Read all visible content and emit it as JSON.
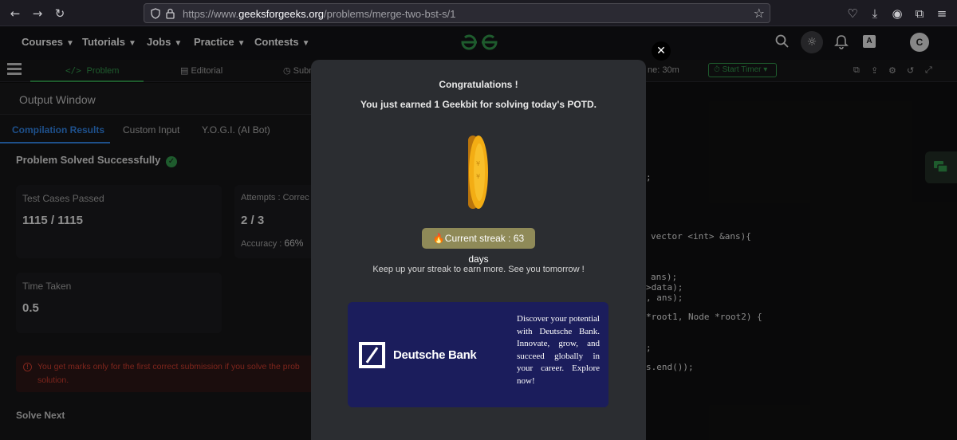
{
  "browser": {
    "url_prefix": "https://www.",
    "url_domain": "geeksforgeeks.org",
    "url_path": "/problems/merge-two-bst-s/1"
  },
  "nav": {
    "items": [
      "Courses",
      "Tutorials",
      "Jobs",
      "Practice",
      "Contests"
    ],
    "logo": "GG",
    "avatar": "C"
  },
  "tabs": {
    "problem": "Problem",
    "editorial": "Editorial",
    "submissions": "Subm",
    "time_fragment": "ne: 30m",
    "start_timer": "Start Timer"
  },
  "left": {
    "output_window": "Output Window",
    "subtabs": [
      "Compilation Results",
      "Custom Input",
      "Y.O.G.I. (AI Bot)"
    ],
    "solved": "Problem Solved Successfully",
    "test_cases_label": "Test Cases Passed",
    "test_cases_value": "1115 / 1115",
    "attempts_label": "Attempts : Correc",
    "attempts_value": "2 / 3",
    "accuracy_label": "Accuracy :",
    "accuracy_value": "66%",
    "time_label": "Time Taken",
    "time_value": "0.5",
    "warning_line1": "You get marks only for the first correct submission if you solve the prob",
    "warning_line2": "solution.",
    "solve_next": "Solve Next"
  },
  "code": {
    "lines": [
      ";",
      "vector <int> &ans){",
      "ans);",
      ">data);",
      ", ans);",
      "*root1, Node *root2) {",
      ";",
      "s.end());"
    ]
  },
  "modal": {
    "congrats": "Congratulations !",
    "earned": "You just earned 1 Geekbit for solving today's POTD.",
    "streak": "Current streak : 63 days",
    "keep_up": "Keep up your streak to earn more. See you tomorrow !",
    "close": "✕"
  },
  "ad": {
    "brand": "Deutsche Bank",
    "text": "Discover your potential with Deutsche Bank. Innovate, grow, and succeed globally in your career. Explore now!"
  },
  "colors": {
    "accent_green": "#2f8d46",
    "tab_blue": "#2e7bd6",
    "modal_bg": "#2b2d31",
    "ad_bg": "#1b1d5c",
    "streak_bg": "#8f8a58"
  }
}
